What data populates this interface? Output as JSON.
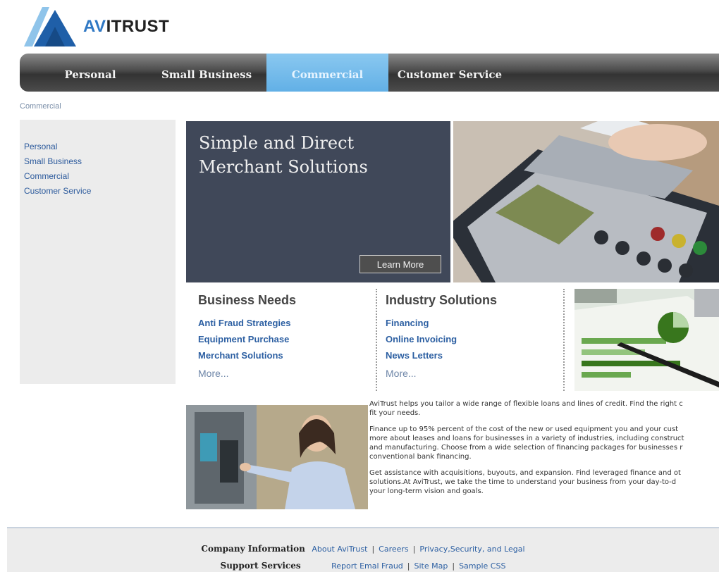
{
  "brand": {
    "prefix": "AV",
    "name": "ITRUST"
  },
  "nav": {
    "items": [
      {
        "label": "Personal"
      },
      {
        "label": "Small Business"
      },
      {
        "label": "Commercial"
      },
      {
        "label": "Customer Service"
      }
    ]
  },
  "breadcrumb": "Commercial",
  "sidebar": {
    "items": [
      {
        "label": "Personal"
      },
      {
        "label": "Small Business"
      },
      {
        "label": "Commercial"
      },
      {
        "label": "Customer Service"
      }
    ]
  },
  "hero": {
    "title": "Simple and Direct Merchant Solutions",
    "button": "Learn More"
  },
  "business_needs": {
    "title": "Business Needs",
    "links": [
      "Anti Fraud Strategies",
      "Equipment Purchase",
      "Merchant Solutions"
    ],
    "more": "More..."
  },
  "industry_solutions": {
    "title": "Industry Solutions",
    "links": [
      "Financing",
      "Online Invoicing",
      "News Letters"
    ],
    "more": "More..."
  },
  "body": {
    "p1": "AviTrust helps you tailor a wide range of flexible loans and lines of credit. Find the right c",
    "p1b": "fit your needs.",
    "p2a": "Finance up to 95% percent of the cost of the new or used equipment you and your cust",
    "p2b": "more about leases and loans for businesses in a variety of industries, including construct",
    "p2c": "and manufacturing. Choose from a wide selection of financing packages for businesses r",
    "p2d": "conventional bank financing.",
    "p3a": "Get assistance with acquisitions, buyouts, and expansion. Find leveraged finance and ot",
    "p3b": "solutions.At AviTrust, we take the time to understand your business from your day-to-d",
    "p3c": "your long-term vision and goals."
  },
  "footer": {
    "company_heading": "Company Information",
    "company_links": [
      "About AviTrust",
      "Careers",
      "Privacy,Security, and Legal"
    ],
    "support_heading": "Support Services",
    "support_links": [
      "Report Emal Fraud",
      "Site Map",
      "Sample CSS"
    ]
  },
  "colors": {
    "accent": "#62b0e6",
    "nav_dark": "#333333",
    "link": "#2c5fa2",
    "hero_bg": "#404859"
  }
}
